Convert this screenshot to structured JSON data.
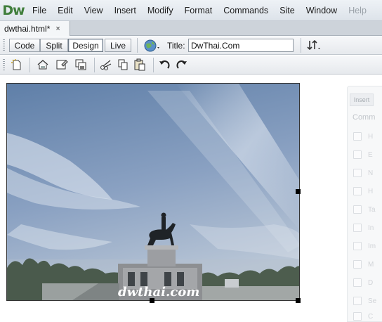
{
  "app": {
    "logo_text": "Dw"
  },
  "menu": [
    {
      "label": "File",
      "enabled": true
    },
    {
      "label": "Edit",
      "enabled": true
    },
    {
      "label": "View",
      "enabled": true
    },
    {
      "label": "Insert",
      "enabled": true
    },
    {
      "label": "Modify",
      "enabled": true
    },
    {
      "label": "Format",
      "enabled": true
    },
    {
      "label": "Commands",
      "enabled": true
    },
    {
      "label": "Site",
      "enabled": true
    },
    {
      "label": "Window",
      "enabled": true
    },
    {
      "label": "Help",
      "enabled": false
    }
  ],
  "document_tab": {
    "label": "dwthai.html*",
    "close_glyph": "×"
  },
  "view_buttons": {
    "code": "Code",
    "split": "Split",
    "design": "Design",
    "live": "Live",
    "active": "Design"
  },
  "title_field": {
    "label": "Title:",
    "value": "DwThai.Com"
  },
  "photo": {
    "watermark": "dwthai.com"
  },
  "insert_panel": {
    "tab": "Insert",
    "category": "Comm",
    "items": [
      {
        "text": "H",
        "icon": "hyperlink-icon"
      },
      {
        "text": "E",
        "icon": "email-link-icon"
      },
      {
        "text": "N",
        "icon": "named-anchor-icon"
      },
      {
        "text": "H",
        "icon": "horizontal-rule-icon"
      },
      {
        "text": "Ta",
        "icon": "table-icon"
      },
      {
        "text": "In",
        "icon": "insert-div-icon"
      },
      {
        "text": "Im",
        "icon": "images-icon"
      },
      {
        "text": "M",
        "icon": "media-icon"
      },
      {
        "text": "D",
        "icon": "date-icon"
      },
      {
        "text": "Se",
        "icon": "server-side-include-icon"
      },
      {
        "text": "C",
        "icon": "comment-icon"
      }
    ]
  },
  "colors": {
    "accent_logo": "#3f7d3a",
    "menu_bg": "#e3e8ee",
    "sky": "#7d95b8"
  }
}
